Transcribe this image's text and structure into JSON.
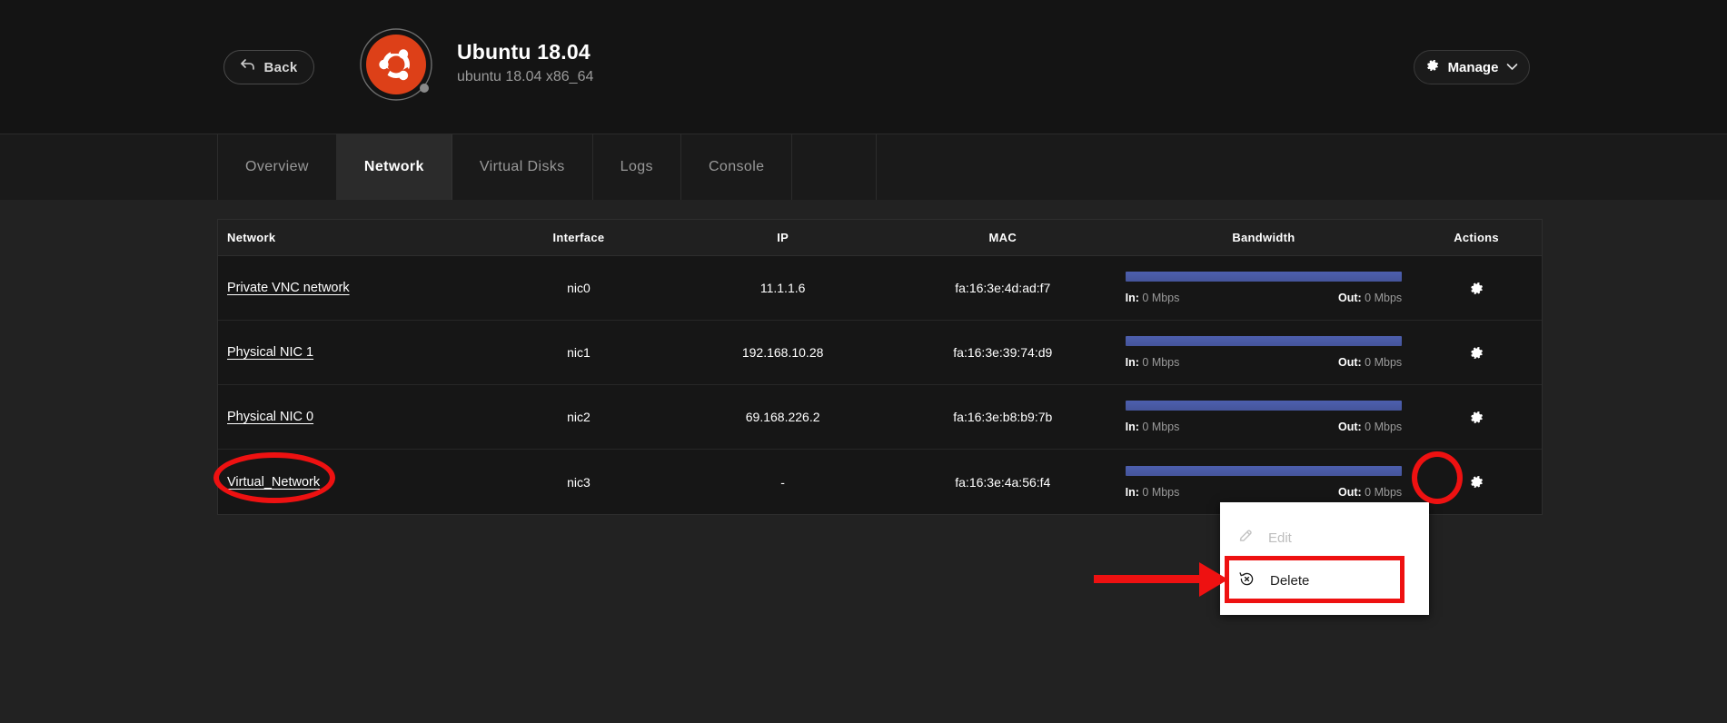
{
  "header": {
    "back_label": "Back",
    "back_icon": "back-arrow-icon",
    "vm_title": "Ubuntu 18.04",
    "vm_subtitle": "ubuntu 18.04 x86_64",
    "logo_icon": "ubuntu-logo-icon",
    "logo_color": "#dd4814",
    "manage_label": "Manage",
    "manage_icon": "gear-icon",
    "manage_chevron_icon": "chevron-down-icon"
  },
  "tabs": [
    {
      "label": "Overview",
      "active": false
    },
    {
      "label": "Network",
      "active": true
    },
    {
      "label": "Virtual Disks",
      "active": false
    },
    {
      "label": "Logs",
      "active": false
    },
    {
      "label": "Console",
      "active": false
    }
  ],
  "table": {
    "columns": [
      "Network",
      "Interface",
      "IP",
      "MAC",
      "Bandwidth",
      "Actions"
    ],
    "bandwidth_in_label": "In:",
    "bandwidth_out_label": "Out:",
    "action_icon": "gear-icon",
    "rows": [
      {
        "network": "Private VNC network",
        "interface": "nic0",
        "ip": "11.1.1.6",
        "mac": "fa:16:3e:4d:ad:f7",
        "bw_in": "0 Mbps",
        "bw_out": "0 Mbps"
      },
      {
        "network": "Physical NIC 1",
        "interface": "nic1",
        "ip": "192.168.10.28",
        "mac": "fa:16:3e:39:74:d9",
        "bw_in": "0 Mbps",
        "bw_out": "0 Mbps"
      },
      {
        "network": "Physical NIC 0",
        "interface": "nic2",
        "ip": "69.168.226.2",
        "mac": "fa:16:3e:b8:b9:7b",
        "bw_in": "0 Mbps",
        "bw_out": "0 Mbps"
      },
      {
        "network": "Virtual_Network",
        "interface": "nic3",
        "ip": "-",
        "mac": "fa:16:3e:4a:56:f4",
        "bw_in": "0 Mbps",
        "bw_out": "0 Mbps"
      }
    ]
  },
  "context_menu": {
    "items": [
      {
        "label": "Edit",
        "icon": "pencil-icon",
        "disabled": true
      },
      {
        "label": "Delete",
        "icon": "delete-circle-icon",
        "disabled": false
      }
    ]
  },
  "annotations": {
    "highlight_color": "#ee1111",
    "ellipse_network_name": "Virtual_Network",
    "ellipse_gear": "row-actions-gear",
    "rect_target": "Delete",
    "arrow": "points-to-delete"
  },
  "colors": {
    "page_bg": "#222222",
    "header_bg": "#141414",
    "tab_bg": "#1a1a1a",
    "tab_active_bg": "#2b2b2b",
    "table_bg": "#161616",
    "table_head_bg": "#202020",
    "bandwidth_bar": "#4d5fae",
    "menu_bg": "#ffffff"
  }
}
